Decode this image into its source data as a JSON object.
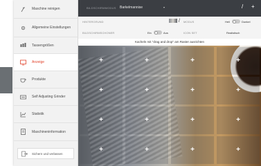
{
  "sidebar": {
    "items": [
      {
        "label": "Maschine reinigen",
        "icon": "cleaning-icon"
      },
      {
        "label": "Allgemeine Einstellungen",
        "icon": "settings-icon"
      },
      {
        "label": "Tassengrößen",
        "icon": "cup-sizes-icon"
      },
      {
        "label": "Anzeige",
        "icon": "display-icon",
        "active": true
      },
      {
        "label": "Produkte",
        "icon": "products-icon"
      },
      {
        "label": "Self Adjusting Grinder",
        "icon": "grinder-icon"
      },
      {
        "label": "Statistik",
        "icon": "statistics-icon"
      },
      {
        "label": "Maschineninformation",
        "icon": "machine-info-icon"
      }
    ],
    "logout_label": "Sichern und verlassen"
  },
  "topbar": {
    "screen_label": "BILDSCHIRMMODUS",
    "screen_value": "Barkelmannise",
    "actions": [
      "/",
      "+"
    ]
  },
  "settings": {
    "background_label": "HINTERGRUND",
    "mode_label": "MODUS",
    "mode_left": "Hell",
    "mode_right": "Dunkel",
    "screensaver_label": "BILDSCHIRMSCHONER",
    "screensaver_on": "Ein",
    "screensaver_off": "Aus",
    "icon_set_label": "ICON SET",
    "icon_set_value": "Realistisch"
  },
  "hint": "Kacheln mit \"drag and drop\" am Raster ausrichten",
  "grid": {
    "rows": 4,
    "cols": 4,
    "cell_label": "+"
  },
  "colors": {
    "accent": "#e2422a",
    "topbar": "#3b3e43"
  }
}
